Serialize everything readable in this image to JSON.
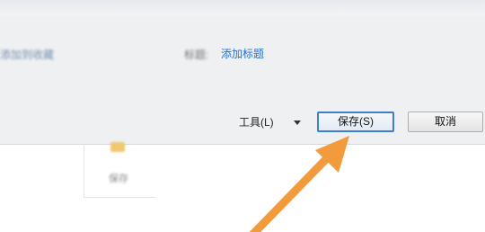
{
  "dialog": {
    "left_blurred_text": "添加到收藏",
    "meta_label": "标题:",
    "meta_link": "添加标题"
  },
  "toolbar": {
    "tools_label": "工具(L)",
    "save_label": "保存(S)",
    "cancel_label": "取消"
  },
  "background": {
    "item_label": "保存"
  },
  "colors": {
    "arrow": "#f39a3c",
    "save_border": "#3c7fcc",
    "link": "#2a6fd0"
  }
}
